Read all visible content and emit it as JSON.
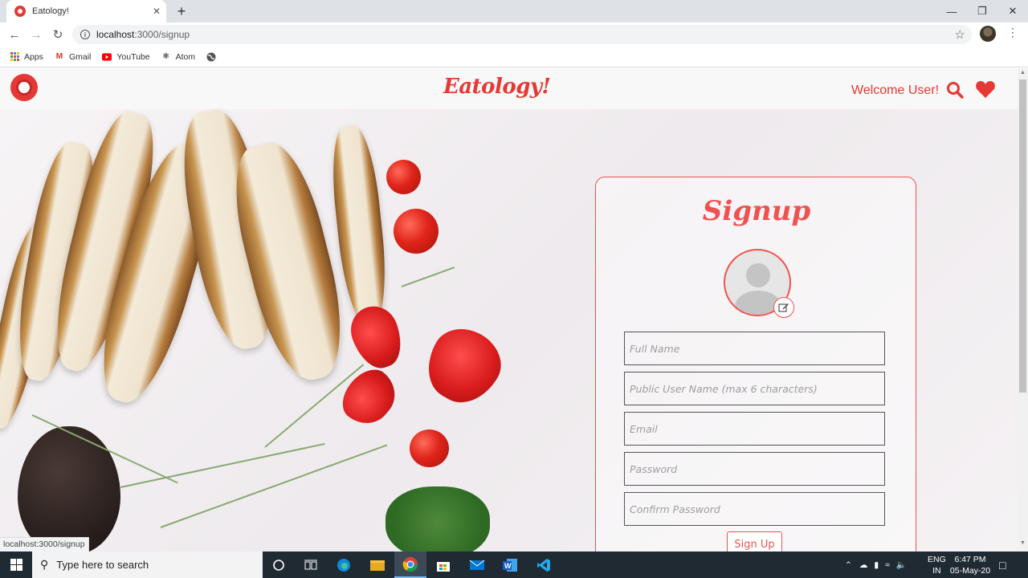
{
  "browser": {
    "tab_title": "Eatology!",
    "tab_close": "✕",
    "new_tab": "+",
    "window_controls": {
      "minimize": "—",
      "maximize": "❐",
      "close": "✕"
    },
    "url_host": "localhost",
    "url_path": ":3000/signup",
    "bookmarks": [
      {
        "label": "Apps",
        "icon": "apps-grid-icon"
      },
      {
        "label": "Gmail",
        "icon": "gmail-icon"
      },
      {
        "label": "YouTube",
        "icon": "youtube-icon"
      },
      {
        "label": "Atom",
        "icon": "atom-icon"
      },
      {
        "label": "",
        "icon": "globe-icon"
      }
    ],
    "status_url": "localhost:3000/signup"
  },
  "site": {
    "brand": "Eatology!",
    "welcome": "Welcome User!",
    "accent_color": "#e53935"
  },
  "signup": {
    "title": "Signup",
    "fields": {
      "full_name": "Full Name",
      "username": "Public User Name (max 6 characters)",
      "email": "Email",
      "password": "Password",
      "confirm_password": "Confirm Password"
    },
    "button": "Sign Up"
  },
  "taskbar": {
    "search_placeholder": "Type here to search",
    "lang_top": "ENG",
    "lang_bottom": "IN",
    "time": "6:47 PM",
    "date": "05-May-20"
  }
}
